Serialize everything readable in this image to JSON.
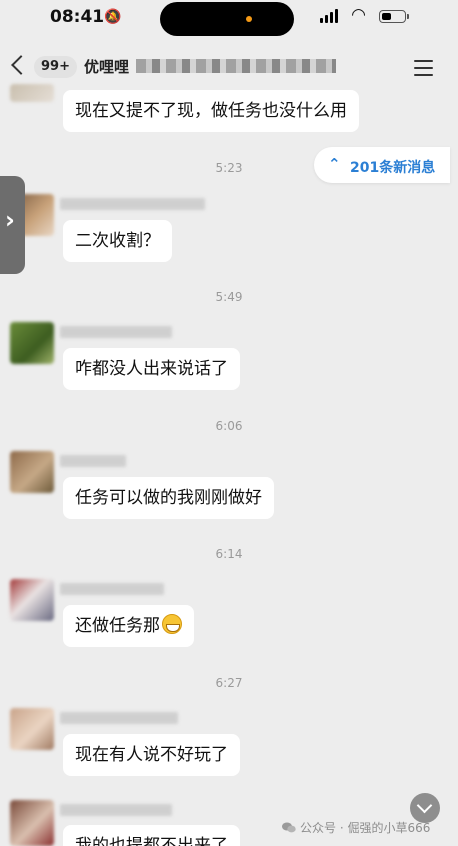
{
  "status": {
    "time": "08:41"
  },
  "nav": {
    "badge": "99+",
    "title": "优哩哩"
  },
  "new_messages_label": "201条新消息",
  "messages": [
    {
      "text": "现在又提不了现，做任务也没什么用"
    },
    {
      "timestamp": "5:23",
      "text": "二次收割？"
    },
    {
      "timestamp": "5:49",
      "text": "咋都没人出来说话了"
    },
    {
      "timestamp": "6:06",
      "text": "任务可以做的我刚刚做好"
    },
    {
      "timestamp": "6:14",
      "text": "还做任务那"
    },
    {
      "timestamp": "6:27",
      "text": "现在有人说不好玩了"
    },
    {
      "text": "我的也提都不出来了"
    }
  ],
  "watermark": "公众号 · 倔强的小草666",
  "icons": {
    "back": "chevron-left-icon",
    "menu": "menu-icon",
    "new_messages": "double-chevron-up-icon",
    "side_handle": "chevron-right-icon",
    "scroll_down": "chevron-down-icon",
    "watermark": "wechat-icon",
    "emoji": "grinning-face-emoji"
  },
  "colors": {
    "background": "#ededed",
    "accent": "#2b7fd4",
    "bubble": "#ffffff"
  }
}
